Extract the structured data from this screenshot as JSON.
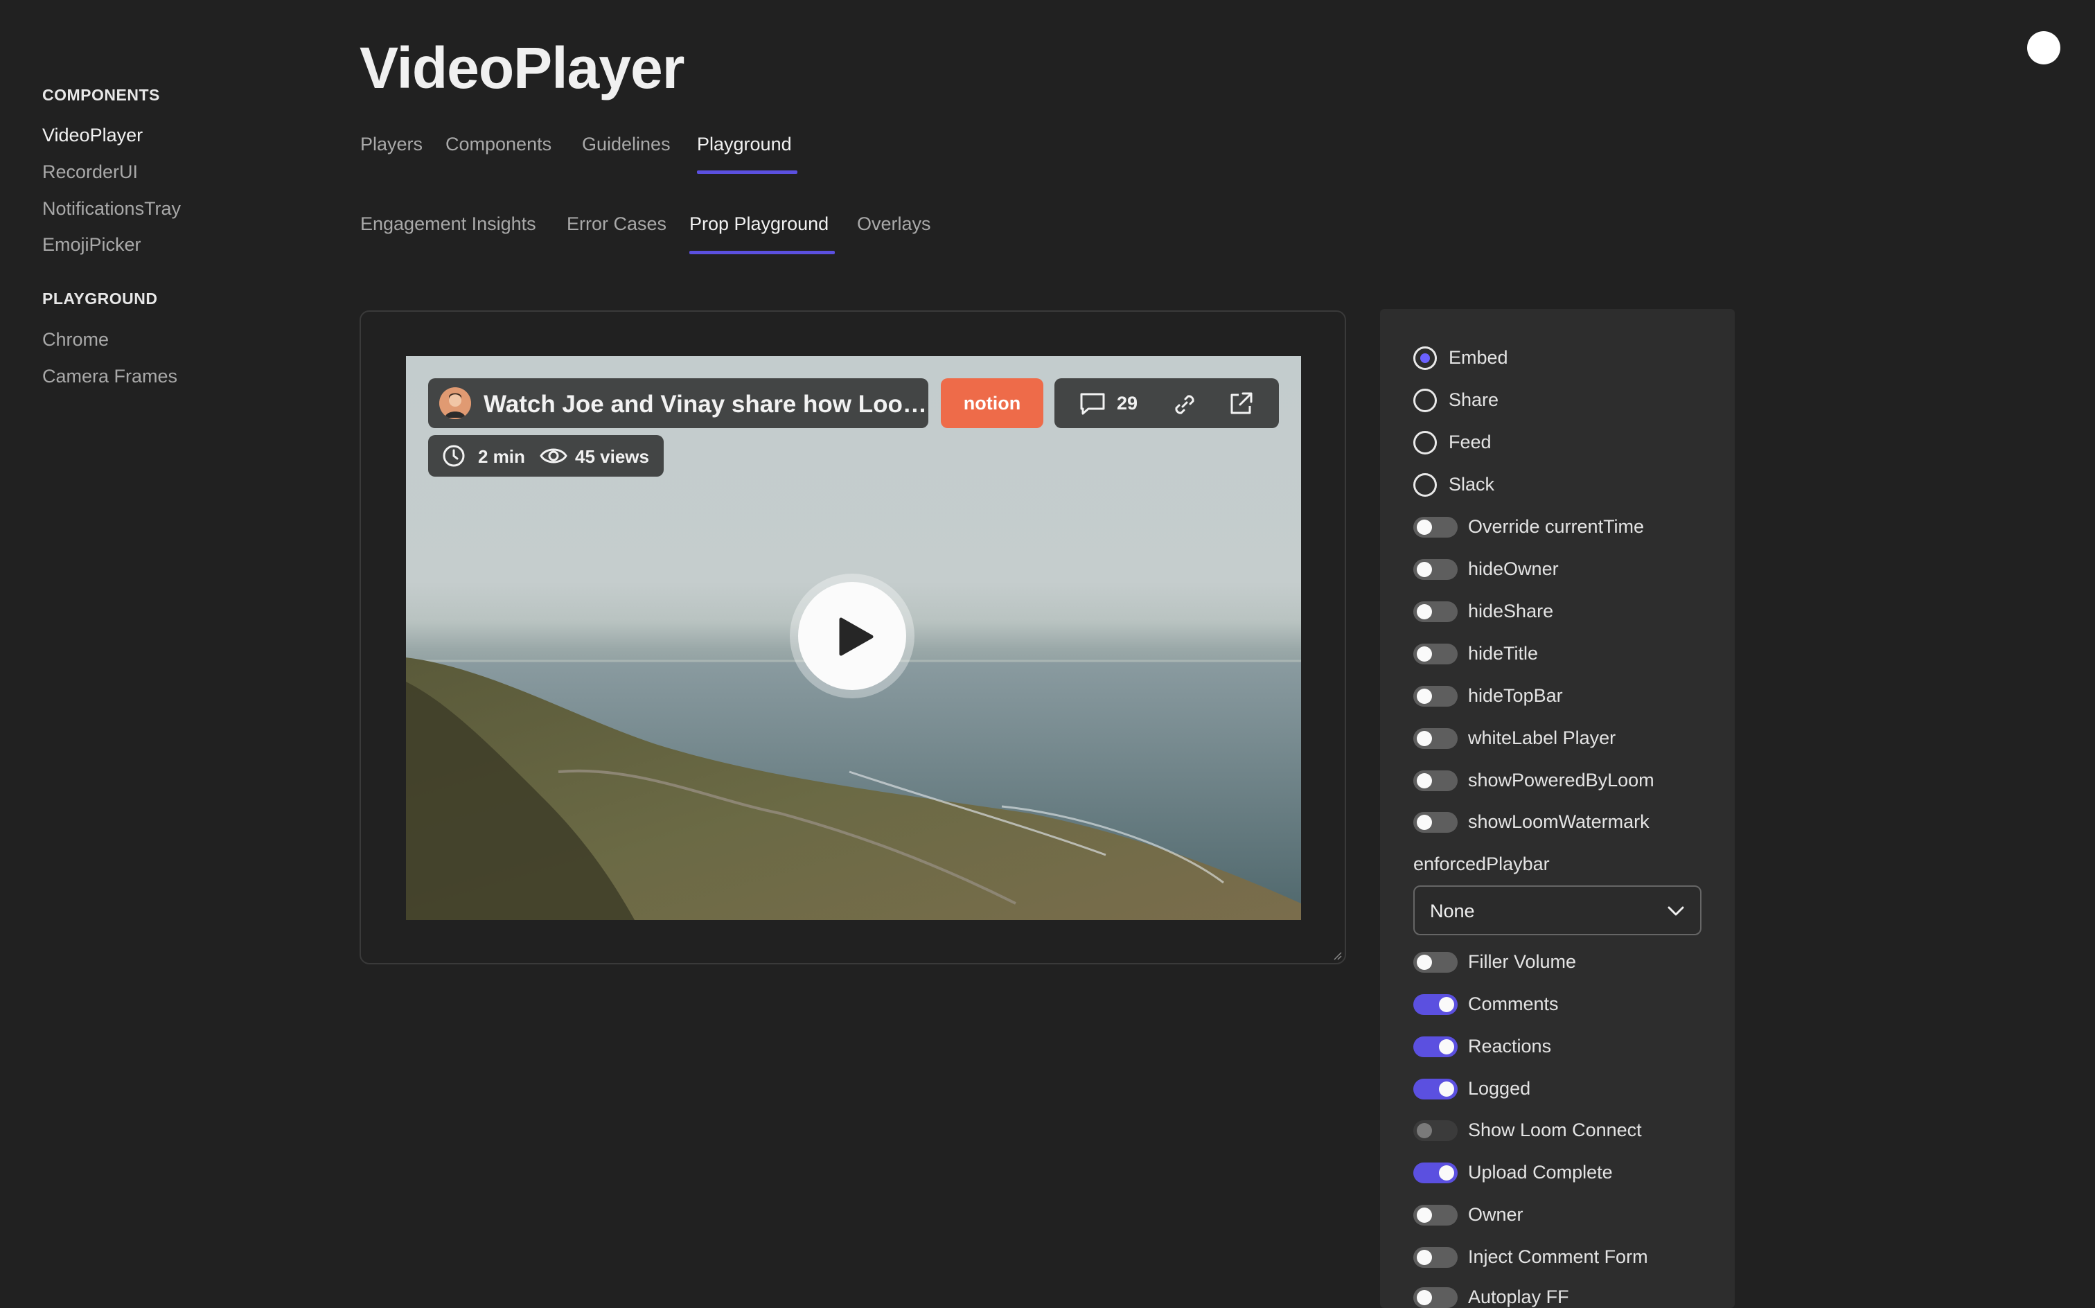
{
  "sidebar": {
    "sections": [
      {
        "title": "COMPONENTS",
        "items": [
          "VideoPlayer",
          "RecorderUI",
          "NotificationsTray",
          "EmojiPicker"
        ]
      },
      {
        "title": "PLAYGROUND",
        "items": [
          "Chrome",
          "Camera Frames"
        ]
      }
    ],
    "active_item": "VideoPlayer"
  },
  "page_title": "VideoPlayer",
  "primary_tabs": [
    "Players",
    "Components",
    "Guidelines",
    "Playground"
  ],
  "primary_active": "Playground",
  "secondary_tabs": [
    "Engagement Insights",
    "Error Cases",
    "Prop Playground",
    "Overlays"
  ],
  "secondary_active": "Prop Playground",
  "player": {
    "title": "Watch Joe and Vinay share how Loo…",
    "brand_badge": "notion",
    "comment_count": "29",
    "duration": "2 min",
    "views": "45 views"
  },
  "controls": {
    "radios": [
      {
        "label": "Embed",
        "checked": true
      },
      {
        "label": "Share",
        "checked": false
      },
      {
        "label": "Feed",
        "checked": false
      },
      {
        "label": "Slack",
        "checked": false
      }
    ],
    "toggles_a": [
      {
        "label": "Override currentTime",
        "state": "off"
      },
      {
        "label": "hideOwner",
        "state": "off"
      },
      {
        "label": "hideShare",
        "state": "off"
      },
      {
        "label": "hideTitle",
        "state": "off"
      },
      {
        "label": "hideTopBar",
        "state": "off"
      },
      {
        "label": "whiteLabel Player",
        "state": "off"
      },
      {
        "label": "showPoweredByLoom",
        "state": "off"
      },
      {
        "label": "showLoomWatermark",
        "state": "off"
      }
    ],
    "select_label": "enforcedPlaybar",
    "select_value": "None",
    "toggles_b": [
      {
        "label": "Filler Volume",
        "state": "off"
      },
      {
        "label": "Comments",
        "state": "on"
      },
      {
        "label": "Reactions",
        "state": "on"
      },
      {
        "label": "Logged",
        "state": "on"
      },
      {
        "label": "Show Loom Connect",
        "state": "disabled"
      },
      {
        "label": "Upload Complete",
        "state": "on"
      },
      {
        "label": "Owner",
        "state": "off"
      },
      {
        "label": "Inject Comment Form",
        "state": "off"
      },
      {
        "label": "Autoplay FF",
        "state": "off"
      }
    ]
  },
  "colors": {
    "background": "#212121",
    "accent": "#5b50e0",
    "brand_badge": "#ee6b49",
    "panel": "#2d2d2d"
  }
}
